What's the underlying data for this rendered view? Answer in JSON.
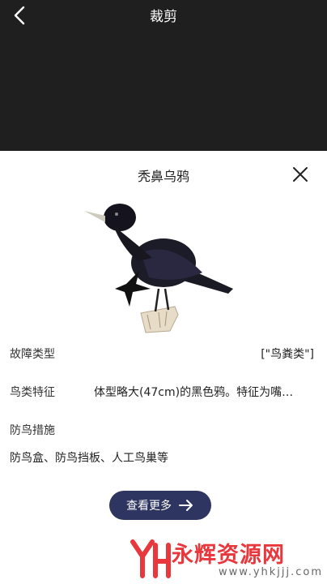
{
  "header": {
    "title": "裁剪"
  },
  "sheet": {
    "title": "秃鼻乌鸦",
    "fault_type_label": "故障类型",
    "fault_type_value": "[\"鸟粪类\"]",
    "features_label": "鸟类特征",
    "features_value": "体型略大(47cm)的黑色鸦。特征为嘴…",
    "measures_label": "防鸟措施",
    "measures_value": "防鸟盒、防鸟挡板、人工鸟巢等",
    "more_button": "查看更多"
  },
  "watermark": {
    "text": "永辉资源网",
    "url": "www.yhkjjj.com"
  },
  "colors": {
    "topbar": "#1f1f1f",
    "button": "#2e3560",
    "watermark": "#e8383d"
  }
}
